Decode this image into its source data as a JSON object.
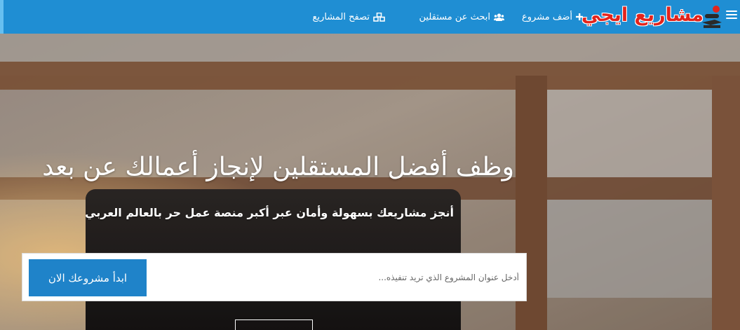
{
  "nav": {
    "logo_text": "مشاريع ايجي",
    "items": [
      {
        "label": "أضف مشروع",
        "icon": "plus-icon"
      },
      {
        "label": "ابحث عن مستقلين",
        "icon": "users-icon"
      },
      {
        "label": "تصفح المشاريع",
        "icon": "cubes-icon"
      }
    ]
  },
  "hero": {
    "title": "وظف أفضل المستقلين لإنجاز أعمالك عن بعد",
    "subtitle": "أنجز مشاريعك بسهولة وأمان عبر أكبر منصة عمل حر بالعالم العربي",
    "search_placeholder": "أدخل عنوان المشروع الذي تريد تنفيذه...",
    "start_button": "ابدأ مشروعك الان"
  },
  "colors": {
    "navbar": "#1f8ed3",
    "button": "#1f83c9",
    "logo": "#e3241c"
  }
}
